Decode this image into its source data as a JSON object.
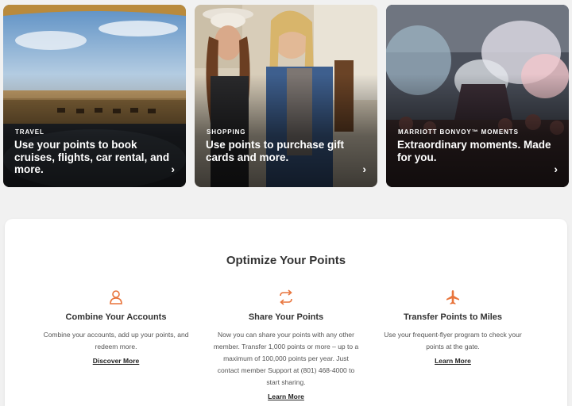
{
  "cards": [
    {
      "eyebrow": "TRAVEL",
      "title": "Use your points to book cruises, flights, car rental, and more.",
      "arrow": "›"
    },
    {
      "eyebrow": "SHOPPING",
      "title": "Use points to purchase gift cards and more.",
      "arrow": "›"
    },
    {
      "eyebrow": "MARRIOTT BONVOY™ MOMENTS",
      "title": "Extraordinary moments. Made for you.",
      "arrow": "›"
    }
  ],
  "optimize": {
    "title": "Optimize Your Points",
    "accent": "#e8743b",
    "features": [
      {
        "icon": "person-icon",
        "heading": "Combine Your Accounts",
        "body": "Combine your accounts, add up your points, and redeem more.",
        "link": "Discover More"
      },
      {
        "icon": "share-arrows-icon",
        "heading": "Share Your Points",
        "body": "Now you can share your points with any other member. Transfer 1,000 points or more – up to a maximum of 100,000 points per year. Just contact member Support at (801) 468-4000 to start sharing.",
        "link": "Learn More"
      },
      {
        "icon": "airplane-icon",
        "heading": "Transfer Points to Miles",
        "body": "Use your frequent-flyer program to check your points at the gate.",
        "link": "Learn More"
      }
    ]
  }
}
